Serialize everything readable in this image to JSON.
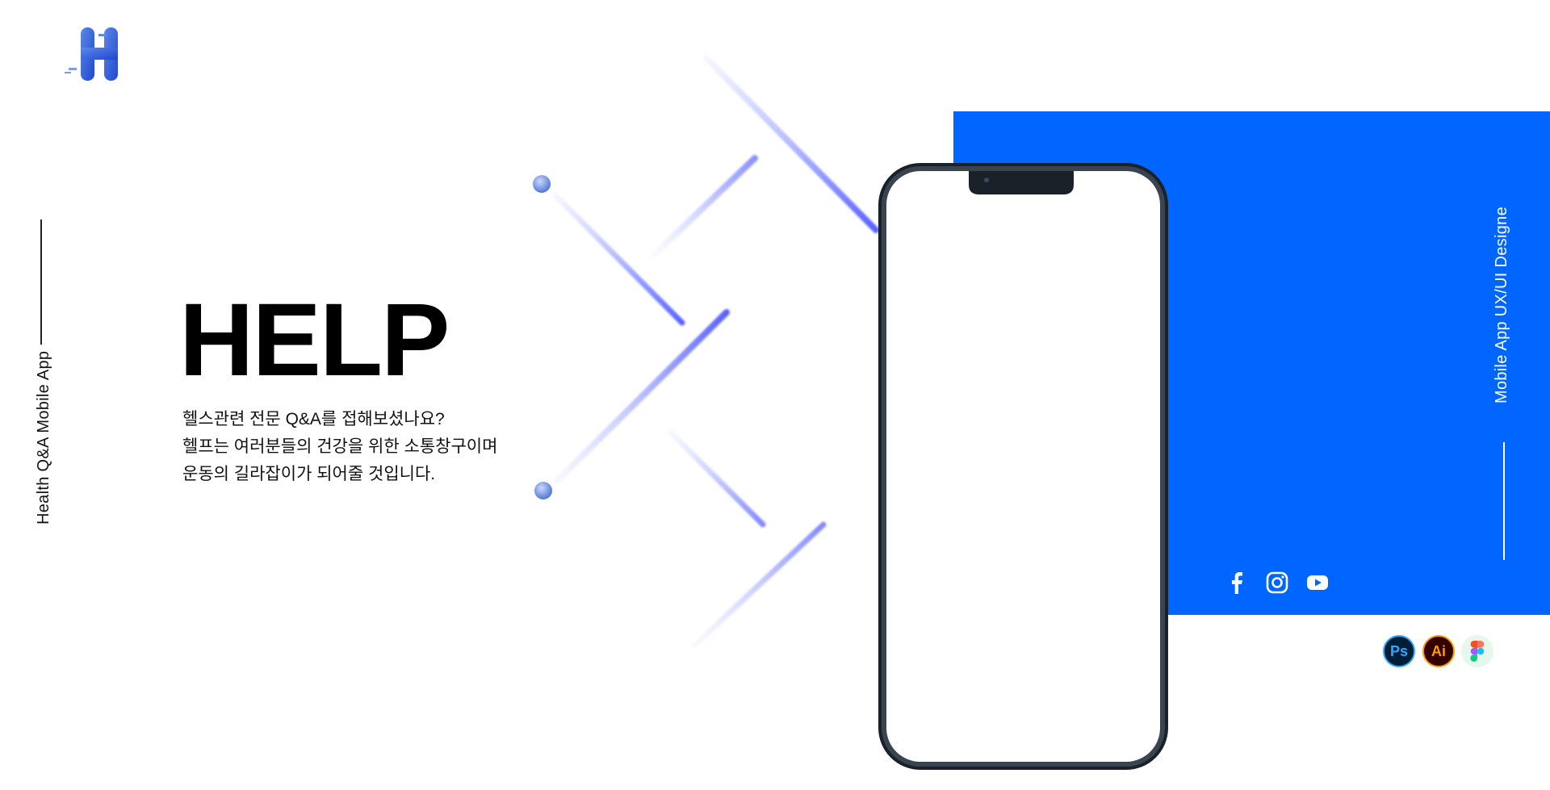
{
  "brand": {
    "logo_letter": "H",
    "logo_icon": "h-logo-icon"
  },
  "left_caption": "Health Q&A Mobile App",
  "hero": {
    "title": "HELP",
    "description": [
      "헬스관련 전문 Q&A를 접해보셨나요?",
      "헬프는 여러분들의 건강을 위한 소통창구이며",
      "운동의 길라잡이가 되어줄 것입니다."
    ]
  },
  "right_caption": "Mobile App UX/UI Designe",
  "social": [
    {
      "icon": "facebook-icon"
    },
    {
      "icon": "instagram-icon"
    },
    {
      "icon": "youtube-icon"
    }
  ],
  "tools": [
    {
      "label": "Ps",
      "icon": "photoshop-icon"
    },
    {
      "label": "Ai",
      "icon": "illustrator-icon"
    },
    {
      "label": "",
      "icon": "figma-icon"
    }
  ],
  "colors": {
    "accent_blue": "#0066ff",
    "logo_blue": "#1f52d6",
    "background": "#ffffff",
    "text": "#111111"
  }
}
